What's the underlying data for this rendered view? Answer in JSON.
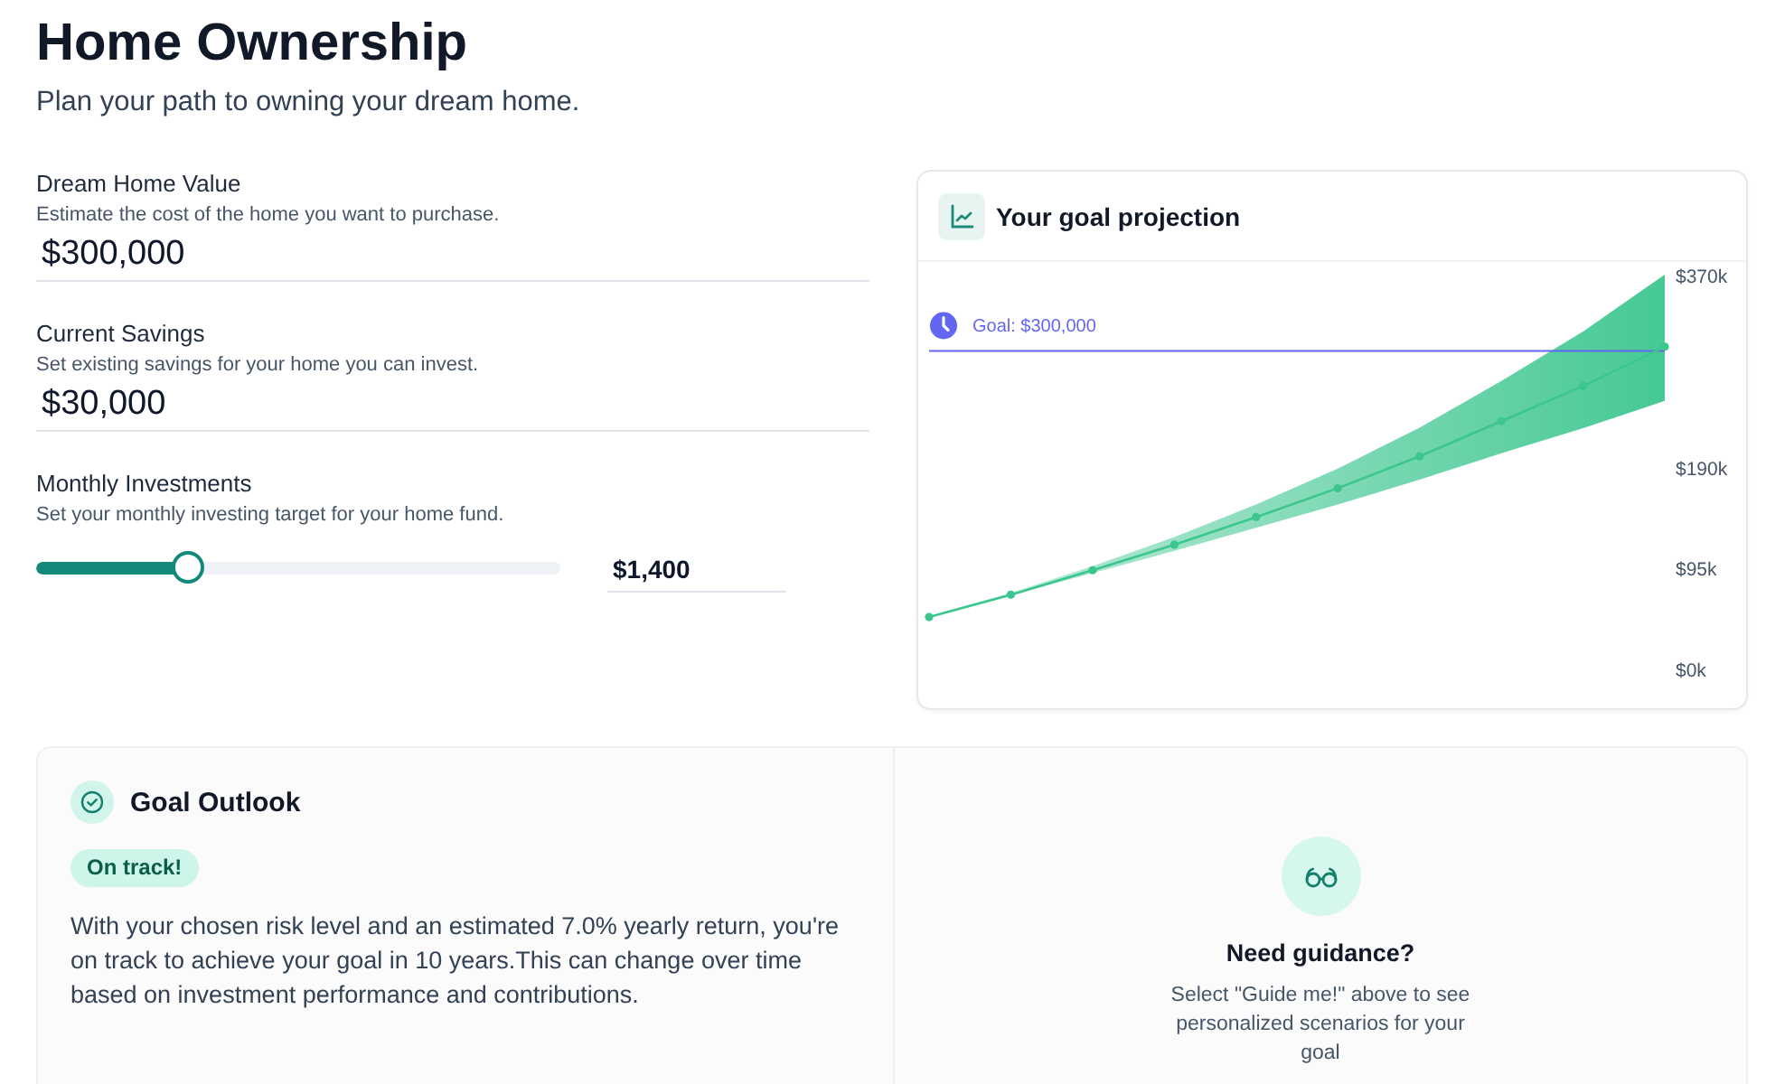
{
  "header": {
    "title": "Home Ownership",
    "subtitle": "Plan your path to owning your dream home."
  },
  "fields": [
    {
      "kind": "input",
      "label": "Dream Home Value",
      "hint": "Estimate the cost of the home you want to purchase.",
      "value": "$300,000"
    },
    {
      "kind": "input",
      "label": "Current Savings",
      "hint": "Set existing savings for your home you can invest.",
      "value": "$30,000"
    },
    {
      "kind": "slider",
      "label": "Monthly Investments",
      "hint": "Set your monthly investing target for your home fund.",
      "level": 0.29,
      "value": "$1,400"
    }
  ],
  "projection": {
    "title": "Your goal projection",
    "chart_data": {
      "type": "line",
      "ylim": [
        0,
        370
      ],
      "yticks": [
        {
          "value": 0,
          "label": "$0k"
        },
        {
          "value": 95,
          "label": "$95k"
        },
        {
          "value": 190,
          "label": "$190k"
        },
        {
          "value": 370,
          "label": "$370k"
        }
      ],
      "series": [
        {
          "color": "#3cc68e",
          "marker": "o",
          "values": [
            50,
            71,
            94,
            118,
            144,
            171,
            201,
            234,
            267,
            304
          ]
        }
      ],
      "ref_lines": [
        {
          "axis": "y",
          "value": 300,
          "label": "Goal: $300,000",
          "color": "#6366f1"
        }
      ]
    }
  },
  "goal_outlook": {
    "title": "Goal Outlook",
    "status": "On track!",
    "message": "With your chosen risk level and an estimated 7.0% yearly return, you're on track to achieve your goal in 10 years.This can change over time based on investment performance and contributions."
  },
  "guidance": {
    "title": "Need guidance?",
    "text": "Select \"Guide me!\" above to see personalized scenarios for your goal"
  }
}
